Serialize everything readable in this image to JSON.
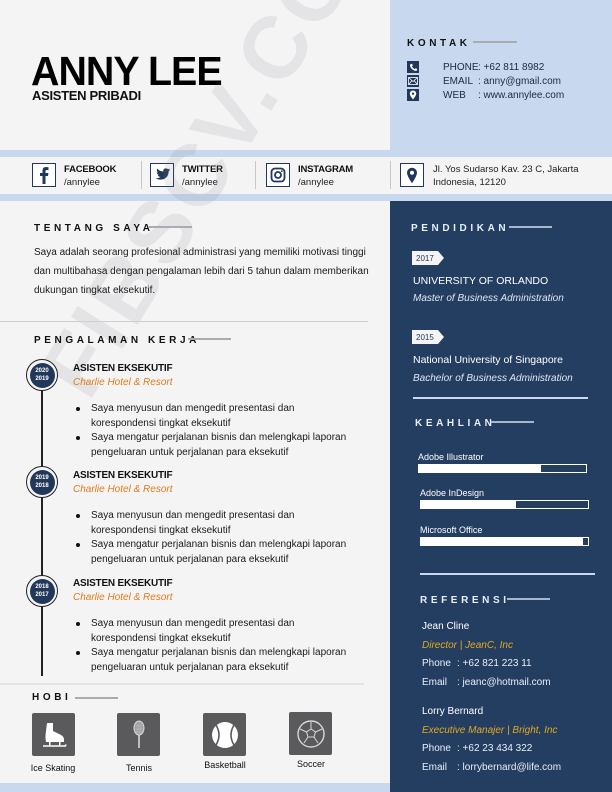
{
  "header": {
    "name": "ANNY LEE",
    "role": "ASISTEN PRIBADI"
  },
  "contact": {
    "title": "KONTAK",
    "items": [
      {
        "icon": "phone-icon",
        "label": "PHONE",
        "value": ": +62 811 8982"
      },
      {
        "icon": "mail-icon",
        "label": "EMAIL",
        "value": ": anny@gmail.com"
      },
      {
        "icon": "location-pin-icon",
        "label": "WEB",
        "value": ": www.annylee.com"
      }
    ]
  },
  "social": [
    {
      "icon": "facebook-icon",
      "title": "FACEBOOK",
      "handle": "/annylee"
    },
    {
      "icon": "twitter-icon",
      "title": "TWITTER",
      "handle": "/annylee"
    },
    {
      "icon": "instagram-icon",
      "title": "INSTAGRAM",
      "handle": "/annylee"
    }
  ],
  "address": {
    "icon": "location-pin-icon",
    "line1": "Jl. Yos Sudarso Kav. 23 C, Jakarta",
    "line2": "Indonesia, 12120"
  },
  "about": {
    "title": "TENTANG SAYA",
    "text": "Saya adalah seorang profesional administrasi yang memiliki motivasi tinggi dan multibahasa dengan pengalaman lebih dari 5 tahun dalam memberikan dukungan tingkat eksekutif."
  },
  "experience": {
    "title": "PENGALAMAN KERJA",
    "jobs": [
      {
        "year_end": "2020",
        "year_start": "2019",
        "title": "ASISTEN EKSEKUTIF",
        "company": "Charlie Hotel & Resort",
        "bullets": [
          "Saya menyusun dan mengedit presentasi dan korespondensi tingkat eksekutif",
          "Saya mengatur perjalanan bisnis dan melengkapi laporan pengeluaran untuk perjalanan para eksekutif"
        ]
      },
      {
        "year_end": "2019",
        "year_start": "2018",
        "title": "ASISTEN EKSEKUTIF",
        "company": "Charlie Hotel & Resort",
        "bullets": [
          "Saya menyusun dan mengedit presentasi dan korespondensi tingkat eksekutif",
          "Saya mengatur perjalanan bisnis dan melengkapi laporan pengeluaran untuk perjalanan para eksekutif"
        ]
      },
      {
        "year_end": "2018",
        "year_start": "2017",
        "title": "ASISTEN EKSEKUTIF",
        "company": "Charlie Hotel & Resort",
        "bullets": [
          "Saya menyusun dan mengedit presentasi dan korespondensi tingkat eksekutif",
          "Saya mengatur perjalanan bisnis dan melengkapi laporan pengeluaran untuk perjalanan para eksekutif"
        ]
      }
    ]
  },
  "hobbies": {
    "title": "HOBI",
    "items": [
      {
        "icon": "ice-skate-icon",
        "label": "Ice Skating"
      },
      {
        "icon": "tennis-racket-icon",
        "label": "Tennis"
      },
      {
        "icon": "ball-icon",
        "label": "Basketball"
      },
      {
        "icon": "soccer-ball-icon",
        "label": "Soccer"
      }
    ]
  },
  "education": {
    "title": "PENDIDIKAN",
    "items": [
      {
        "year": "2017",
        "school": "UNIVERSITY OF ORLANDO",
        "degree": "Master of Business Administration"
      },
      {
        "year": "2015",
        "school": "National University of Singapore",
        "degree": "Bachelor of Business Administration"
      }
    ]
  },
  "skills": {
    "title": "KEAHLIAN",
    "items": [
      {
        "label": "Adobe Illustrator",
        "level": 0.73
      },
      {
        "label": "Adobe InDesign",
        "level": 0.57
      },
      {
        "label": "Microsoft Office",
        "level": 0.97
      }
    ]
  },
  "references": {
    "title": "REFERENSI",
    "items": [
      {
        "name": "Jean Cline",
        "role": "Director | JeanC, Inc",
        "phone_label": "Phone",
        "phone": ": +62 821 223 11",
        "email_label": "Email",
        "email": ": jeanc@hotmail.com"
      },
      {
        "name": "Lorry Bernard",
        "role": "Executive Manajer | Bright, Inc",
        "phone_label": "Phone",
        "phone": ": +62 23 434 322",
        "email_label": "Email",
        "email": ": lorrybernard@life.com"
      }
    ]
  },
  "colors": {
    "navy": "#243e62",
    "light_blue": "#c7d8ef",
    "accent_orange": "#e07b1a",
    "accent_gold": "#e3a81d",
    "background": "#f4f4f5"
  },
  "watermark": "FIBSCV.COM"
}
